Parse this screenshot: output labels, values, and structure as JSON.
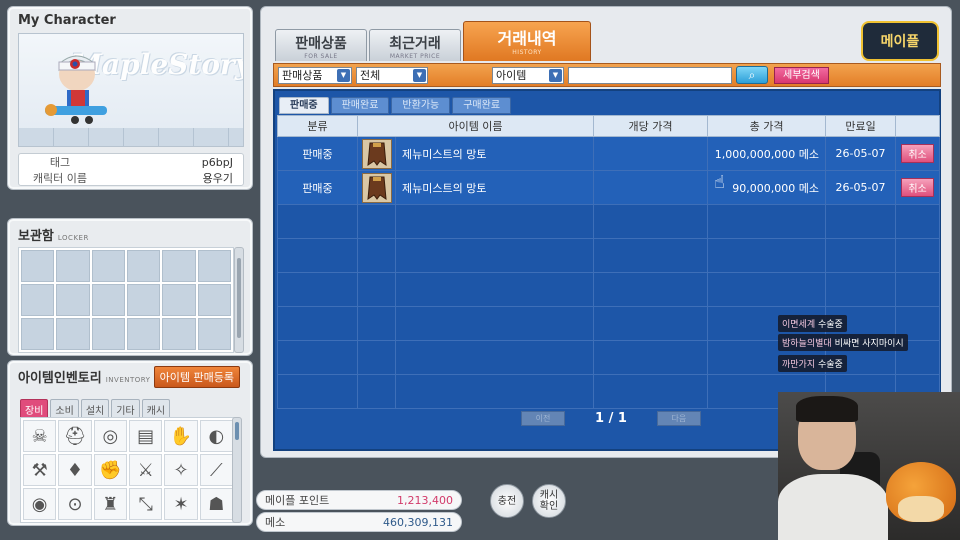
{
  "character": {
    "title": "My Character",
    "logo": "MapleStory",
    "tag_label": "태그",
    "tag_value": "p6bpJ",
    "name_label": "캐릭터 이름",
    "name_value": "용우기"
  },
  "locker": {
    "title": "보관함",
    "sub": "LOCKER"
  },
  "inventory": {
    "title": "아이템인벤토리",
    "sub": "INVENTORY",
    "register_button": "아이템 판매등록",
    "tabs": [
      "장비",
      "소비",
      "설치",
      "기타",
      "캐시"
    ]
  },
  "points": {
    "maple_label": "메이플 포인트",
    "maple_value": "1,213,400",
    "meso_label": "메소",
    "meso_value": "460,309,131"
  },
  "buttons": {
    "charge": "충전",
    "cash_check_1": "캐시",
    "cash_check_2": "확인"
  },
  "main_tabs": [
    {
      "label": "판매상품",
      "sub": "FOR SALE"
    },
    {
      "label": "최근거래",
      "sub": "MARKET PRICE"
    },
    {
      "label": "거래내역",
      "sub": "HISTORY"
    }
  ],
  "filters": {
    "category": "판매상품",
    "scope": "전체",
    "type": "아이템",
    "search_value": "",
    "detail_search": "세부검색"
  },
  "sub_tabs": [
    "판매중",
    "판매완료",
    "반환가능",
    "구매완료"
  ],
  "table": {
    "headers": [
      "분류",
      "아이템 이름",
      "개당 가격",
      "총 가격",
      "만료일"
    ],
    "rows": [
      {
        "status": "판매중",
        "name": "제뉴미스트의 망토",
        "unit_price": "",
        "total": "1,000,000,000 메소",
        "expiry": "26-05-07",
        "action": "취소"
      },
      {
        "status": "판매중",
        "name": "제뉴미스트의 망토",
        "unit_price": "",
        "total": "90,000,000 메소",
        "expiry": "26-05-07",
        "action": "취소"
      }
    ]
  },
  "pager": {
    "prev": "이전",
    "page": "1 / 1",
    "next": "다음"
  },
  "chat": [
    {
      "name": "이면세계",
      "msg": "수술중"
    },
    {
      "name": "밤하늘의별대",
      "msg": "비싸면 사지마이시"
    },
    {
      "name": "까만가지",
      "msg": "수술중"
    }
  ],
  "brand": "메이플",
  "colors": {
    "accent_orange": "#e37e28",
    "table_blue": "#1d56a8",
    "pink": "#d8376f"
  }
}
